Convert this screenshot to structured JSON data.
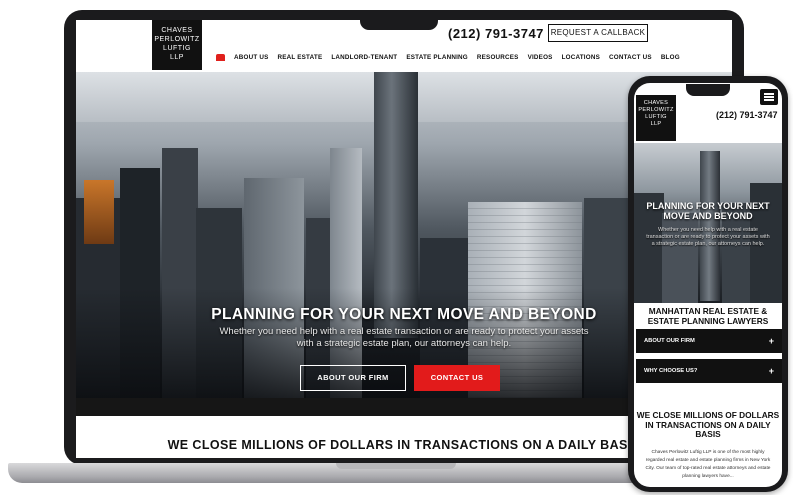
{
  "laptop": {
    "logo_lines": [
      "CHAVES",
      "PERLOWITZ",
      "LUFTIG",
      "LLP"
    ],
    "phone": "(212) 791-3747",
    "callback_button": "REQUEST A CALLBACK",
    "nav": [
      "ABOUT US",
      "REAL ESTATE",
      "LANDLORD-TENANT",
      "ESTATE PLANNING",
      "RESOURCES",
      "VIDEOS",
      "LOCATIONS",
      "CONTACT US",
      "BLOG"
    ],
    "hero": {
      "title": "PLANNING FOR YOUR NEXT MOVE AND BEYOND",
      "subtitle": "Whether you need help with a real estate transaction or are ready to protect your assets with a strategic estate plan, our attorneys can help.",
      "btn_about": "ABOUT OUR FIRM",
      "btn_contact": "CONTACT US"
    },
    "band_title": "WE CLOSE MILLIONS OF DOLLARS IN TRANSACTIONS ON A DAILY BASIS"
  },
  "phone": {
    "logo_lines": [
      "CHAVES",
      "PERLOWITZ",
      "LUFTIG",
      "LLP"
    ],
    "phone": "(212) 791-3747",
    "hero_title": "PLANNING FOR YOUR NEXT MOVE AND BEYOND",
    "hero_subtitle": "Whether you need help with a real estate transaction or are ready to protect your assets with a strategic estate plan, our attorneys can help.",
    "section_title": "MANHATTAN REAL ESTATE & ESTATE PLANNING LAWYERS",
    "accordion": [
      "ABOUT OUR FIRM",
      "WHY CHOOSE US?"
    ],
    "accordion_toggle": "+",
    "section2_title": "WE CLOSE MILLIONS OF DOLLARS IN TRANSACTIONS ON A DAILY BASIS",
    "body": "Chaves Perlowitz Luftig LLP is one of the most highly regarded real estate and estate planning firms in New York City. Our team of top-rated real estate attorneys and estate planning lawyers have..."
  },
  "colors": {
    "accent": "#e21b1b",
    "dark": "#111111"
  }
}
